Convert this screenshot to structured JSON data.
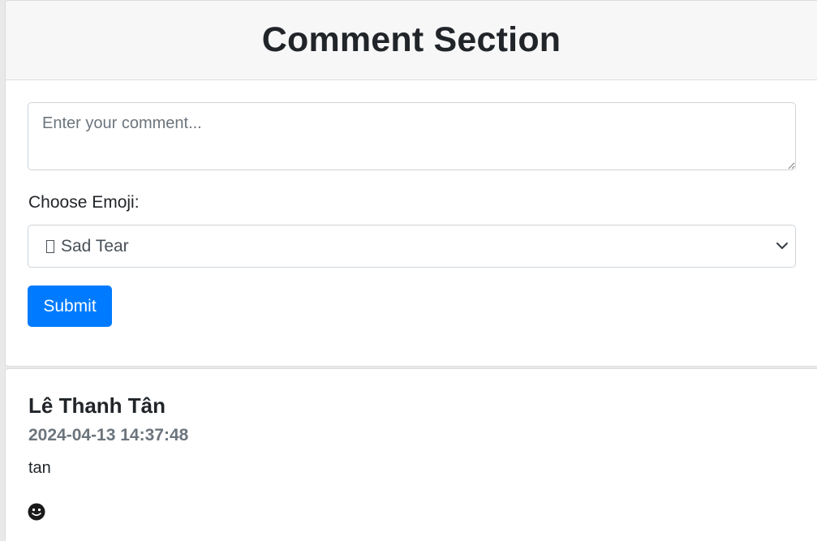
{
  "header": {
    "title": "Comment Section"
  },
  "form": {
    "comment_placeholder": "Enter your comment...",
    "comment_value": "",
    "emoji_label": "Choose Emoji:",
    "emoji_selected": "Sad Tear",
    "emoji_selected_icon": "missing-glyph-box-icon",
    "submit_label": "Submit",
    "accent_color": "#007bff"
  },
  "comments": [
    {
      "author": "Lê Thanh Tân",
      "timestamp": "2024-04-13 14:37:48",
      "text": "tan",
      "emoji_icon": "smiley-face-icon"
    }
  ]
}
